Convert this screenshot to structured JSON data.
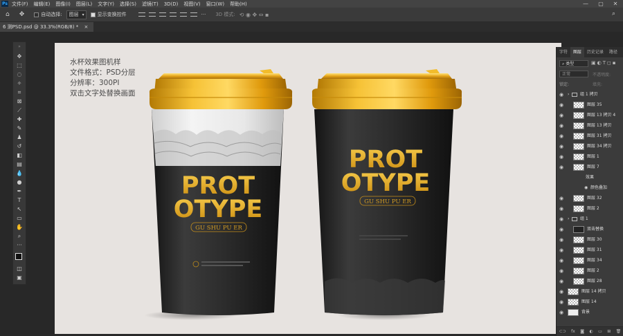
{
  "menu": {
    "app_icon": "Ps",
    "items": [
      "文件(F)",
      "编辑(E)",
      "图像(I)",
      "图层(L)",
      "文字(Y)",
      "选择(S)",
      "滤镜(T)",
      "3D(D)",
      "视图(V)",
      "窗口(W)",
      "帮助(H)"
    ],
    "window_controls": [
      "—",
      "▢",
      "✕"
    ]
  },
  "options": {
    "auto_select_label": "自动选择:",
    "auto_select_value": "图层",
    "show_transform_label": "显示变换控件",
    "mode_3d_label": "3D 模式:",
    "more_label": "···"
  },
  "tab": {
    "title": "6 测PSD.psd @ 33.3%(RGB/8) *",
    "close": "×"
  },
  "canvas_text": {
    "line1": "水杯效果图机样",
    "line2": "文件格式：PSD分层",
    "line3": "分辨率：300PI",
    "line4": "双击文字处替换画面"
  },
  "cup_left": {
    "brand1": "PROT",
    "brand2": "OTYPE",
    "sub": "GU SHU PU ER"
  },
  "cup_right": {
    "brand1": "PROT",
    "brand2": "OTYPE",
    "sub": "GU SHU PU ER"
  },
  "panel": {
    "tabs": [
      "字符",
      "图层",
      "历史记录",
      "路径"
    ],
    "filter_kind": "类型",
    "blend_mode": "正常",
    "opacity_label": "不透明度:",
    "lock_label": "锁定:",
    "fill_label": "填充:",
    "layers": [
      {
        "name": "组 1 拷贝",
        "kind": "group"
      },
      {
        "name": "图层 35",
        "kind": "layer"
      },
      {
        "name": "图层 13 拷贝 4",
        "kind": "layer"
      },
      {
        "name": "图层 13 拷贝",
        "kind": "layer"
      },
      {
        "name": "图层 31 拷贝",
        "kind": "layer"
      },
      {
        "name": "图层 34 拷贝",
        "kind": "layer"
      },
      {
        "name": "图层 1",
        "kind": "layer"
      },
      {
        "name": "图层 7",
        "kind": "layer"
      },
      {
        "name": "效果",
        "kind": "fx"
      },
      {
        "name": "颜色叠加",
        "kind": "fx-item"
      },
      {
        "name": "图层 32",
        "kind": "layer"
      },
      {
        "name": "图层 2",
        "kind": "layer"
      },
      {
        "name": "组 1",
        "kind": "group"
      },
      {
        "name": "双击替换",
        "kind": "smart"
      },
      {
        "name": "图层 30",
        "kind": "layer"
      },
      {
        "name": "图层 31",
        "kind": "layer"
      },
      {
        "name": "图层 34",
        "kind": "layer"
      },
      {
        "name": "图层 2",
        "kind": "layer"
      },
      {
        "name": "图层 28",
        "kind": "layer"
      },
      {
        "name": "图层 14 拷贝",
        "kind": "layer"
      },
      {
        "name": "图层 14",
        "kind": "layer"
      },
      {
        "name": "背景",
        "kind": "background"
      }
    ],
    "footer_icons": [
      "link-icon",
      "fx-icon",
      "mask-icon",
      "adjustment-icon",
      "folder-icon",
      "new-layer-icon",
      "trash-icon"
    ]
  },
  "colors": {
    "gold": "#e3a514",
    "cup_black": "#2a2a2a",
    "canvas_bg": "#e7e3e0",
    "ui_dark": "#282828"
  }
}
